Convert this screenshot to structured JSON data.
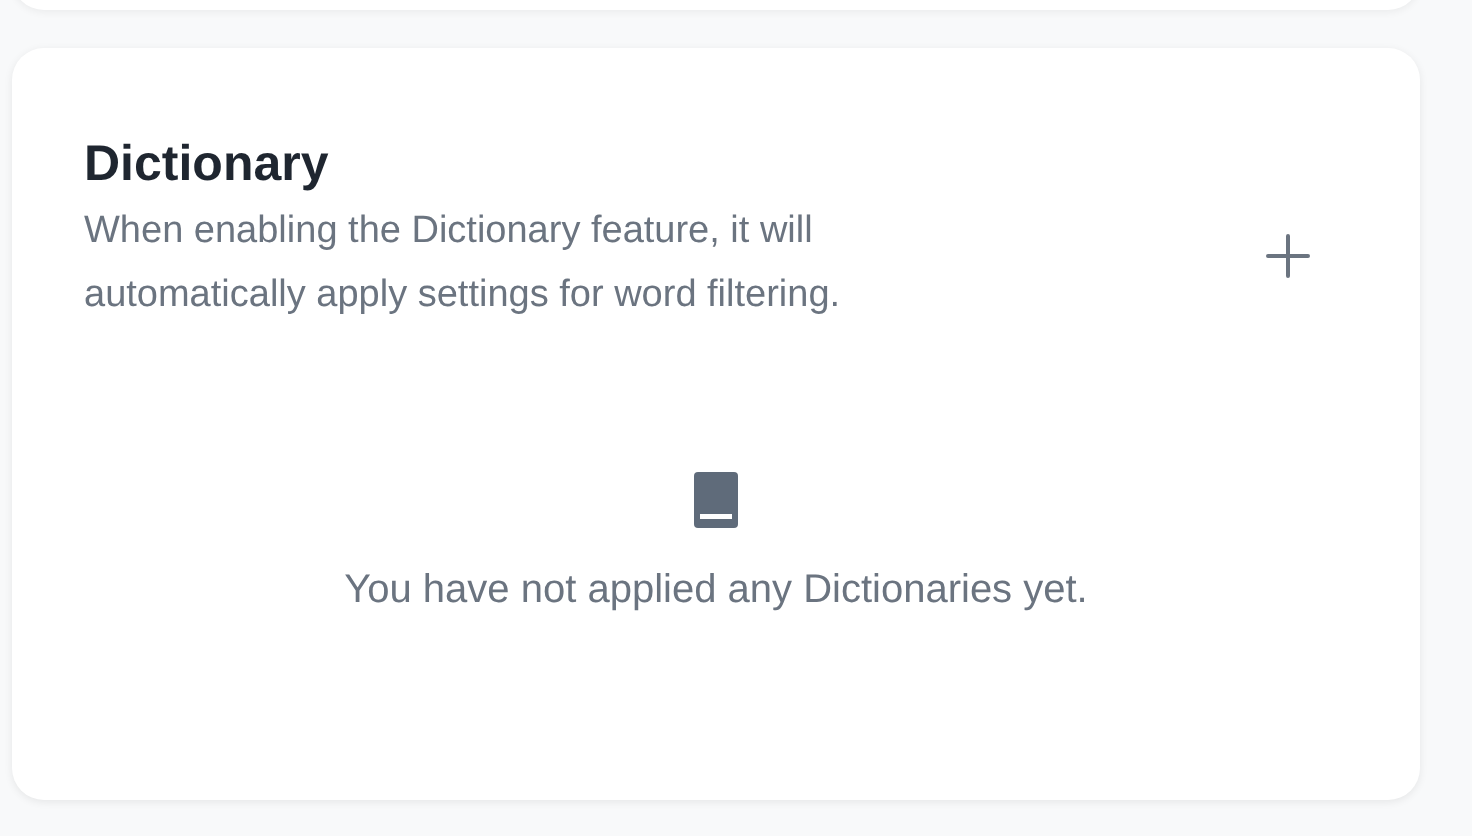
{
  "card": {
    "title": "Dictionary",
    "description": "When enabling the Dictionary feature, it will automatically apply settings for word filtering.",
    "empty_message": "You have not applied any Dictionaries yet."
  }
}
